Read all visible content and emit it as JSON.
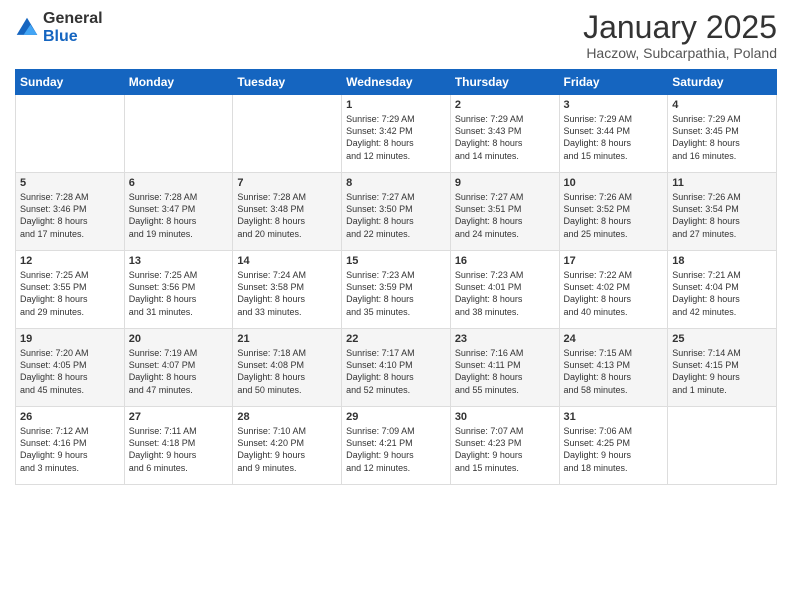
{
  "logo": {
    "general": "General",
    "blue": "Blue"
  },
  "header": {
    "month": "January 2025",
    "location": "Haczow, Subcarpathia, Poland"
  },
  "weekdays": [
    "Sunday",
    "Monday",
    "Tuesday",
    "Wednesday",
    "Thursday",
    "Friday",
    "Saturday"
  ],
  "weeks": [
    [
      {
        "day": "",
        "info": ""
      },
      {
        "day": "",
        "info": ""
      },
      {
        "day": "",
        "info": ""
      },
      {
        "day": "1",
        "info": "Sunrise: 7:29 AM\nSunset: 3:42 PM\nDaylight: 8 hours\nand 12 minutes."
      },
      {
        "day": "2",
        "info": "Sunrise: 7:29 AM\nSunset: 3:43 PM\nDaylight: 8 hours\nand 14 minutes."
      },
      {
        "day": "3",
        "info": "Sunrise: 7:29 AM\nSunset: 3:44 PM\nDaylight: 8 hours\nand 15 minutes."
      },
      {
        "day": "4",
        "info": "Sunrise: 7:29 AM\nSunset: 3:45 PM\nDaylight: 8 hours\nand 16 minutes."
      }
    ],
    [
      {
        "day": "5",
        "info": "Sunrise: 7:28 AM\nSunset: 3:46 PM\nDaylight: 8 hours\nand 17 minutes."
      },
      {
        "day": "6",
        "info": "Sunrise: 7:28 AM\nSunset: 3:47 PM\nDaylight: 8 hours\nand 19 minutes."
      },
      {
        "day": "7",
        "info": "Sunrise: 7:28 AM\nSunset: 3:48 PM\nDaylight: 8 hours\nand 20 minutes."
      },
      {
        "day": "8",
        "info": "Sunrise: 7:27 AM\nSunset: 3:50 PM\nDaylight: 8 hours\nand 22 minutes."
      },
      {
        "day": "9",
        "info": "Sunrise: 7:27 AM\nSunset: 3:51 PM\nDaylight: 8 hours\nand 24 minutes."
      },
      {
        "day": "10",
        "info": "Sunrise: 7:26 AM\nSunset: 3:52 PM\nDaylight: 8 hours\nand 25 minutes."
      },
      {
        "day": "11",
        "info": "Sunrise: 7:26 AM\nSunset: 3:54 PM\nDaylight: 8 hours\nand 27 minutes."
      }
    ],
    [
      {
        "day": "12",
        "info": "Sunrise: 7:25 AM\nSunset: 3:55 PM\nDaylight: 8 hours\nand 29 minutes."
      },
      {
        "day": "13",
        "info": "Sunrise: 7:25 AM\nSunset: 3:56 PM\nDaylight: 8 hours\nand 31 minutes."
      },
      {
        "day": "14",
        "info": "Sunrise: 7:24 AM\nSunset: 3:58 PM\nDaylight: 8 hours\nand 33 minutes."
      },
      {
        "day": "15",
        "info": "Sunrise: 7:23 AM\nSunset: 3:59 PM\nDaylight: 8 hours\nand 35 minutes."
      },
      {
        "day": "16",
        "info": "Sunrise: 7:23 AM\nSunset: 4:01 PM\nDaylight: 8 hours\nand 38 minutes."
      },
      {
        "day": "17",
        "info": "Sunrise: 7:22 AM\nSunset: 4:02 PM\nDaylight: 8 hours\nand 40 minutes."
      },
      {
        "day": "18",
        "info": "Sunrise: 7:21 AM\nSunset: 4:04 PM\nDaylight: 8 hours\nand 42 minutes."
      }
    ],
    [
      {
        "day": "19",
        "info": "Sunrise: 7:20 AM\nSunset: 4:05 PM\nDaylight: 8 hours\nand 45 minutes."
      },
      {
        "day": "20",
        "info": "Sunrise: 7:19 AM\nSunset: 4:07 PM\nDaylight: 8 hours\nand 47 minutes."
      },
      {
        "day": "21",
        "info": "Sunrise: 7:18 AM\nSunset: 4:08 PM\nDaylight: 8 hours\nand 50 minutes."
      },
      {
        "day": "22",
        "info": "Sunrise: 7:17 AM\nSunset: 4:10 PM\nDaylight: 8 hours\nand 52 minutes."
      },
      {
        "day": "23",
        "info": "Sunrise: 7:16 AM\nSunset: 4:11 PM\nDaylight: 8 hours\nand 55 minutes."
      },
      {
        "day": "24",
        "info": "Sunrise: 7:15 AM\nSunset: 4:13 PM\nDaylight: 8 hours\nand 58 minutes."
      },
      {
        "day": "25",
        "info": "Sunrise: 7:14 AM\nSunset: 4:15 PM\nDaylight: 9 hours\nand 1 minute."
      }
    ],
    [
      {
        "day": "26",
        "info": "Sunrise: 7:12 AM\nSunset: 4:16 PM\nDaylight: 9 hours\nand 3 minutes."
      },
      {
        "day": "27",
        "info": "Sunrise: 7:11 AM\nSunset: 4:18 PM\nDaylight: 9 hours\nand 6 minutes."
      },
      {
        "day": "28",
        "info": "Sunrise: 7:10 AM\nSunset: 4:20 PM\nDaylight: 9 hours\nand 9 minutes."
      },
      {
        "day": "29",
        "info": "Sunrise: 7:09 AM\nSunset: 4:21 PM\nDaylight: 9 hours\nand 12 minutes."
      },
      {
        "day": "30",
        "info": "Sunrise: 7:07 AM\nSunset: 4:23 PM\nDaylight: 9 hours\nand 15 minutes."
      },
      {
        "day": "31",
        "info": "Sunrise: 7:06 AM\nSunset: 4:25 PM\nDaylight: 9 hours\nand 18 minutes."
      },
      {
        "day": "",
        "info": ""
      }
    ]
  ]
}
